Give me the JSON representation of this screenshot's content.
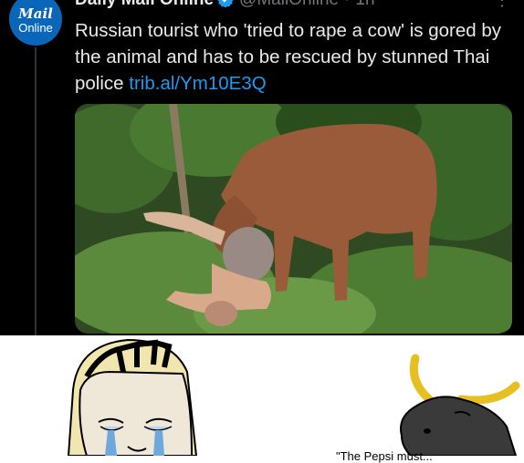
{
  "tweet": {
    "avatar_line1": "Mail",
    "avatar_line2": "Online",
    "display_name": "Daily Mail Online",
    "handle": "@MailOnline",
    "time": "1h",
    "text": "Russian tourist who 'tried to rape a cow' is gored by the animal and has to be rescued by stunned Thai police",
    "link": "trib.al/Ym10E3Q"
  },
  "meme": {
    "caption": "\"The Pepsi must..."
  },
  "icons": [
    "verified-badge-icon",
    "more-options-icon"
  ],
  "colors": {
    "background": "#000000",
    "text": "#e7e9ea",
    "secondary": "#71767b",
    "link": "#1d9bf0",
    "verified": "#1d9bf0"
  }
}
